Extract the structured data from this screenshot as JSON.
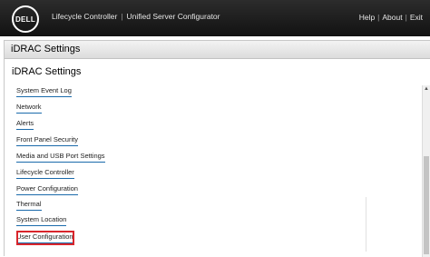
{
  "header": {
    "logo": "DELL",
    "product": "Lifecycle Controller",
    "subtitle": "Unified Server Configurator",
    "links": [
      "Help",
      "About",
      "Exit"
    ]
  },
  "panel": {
    "title": "iDRAC Settings",
    "section_title": "iDRAC Settings"
  },
  "menu": {
    "items": [
      "System Event Log",
      "Network",
      "Alerts",
      "Front Panel Security",
      "Media and USB Port Settings",
      "Lifecycle Controller",
      "Power Configuration",
      "Thermal",
      "System Location",
      "User Configuration"
    ],
    "highlighted": "User Configuration"
  },
  "colors": {
    "highlight_border": "#d9252b",
    "link_underline": "#1a6aab",
    "topbar": "#1a1a1a"
  }
}
